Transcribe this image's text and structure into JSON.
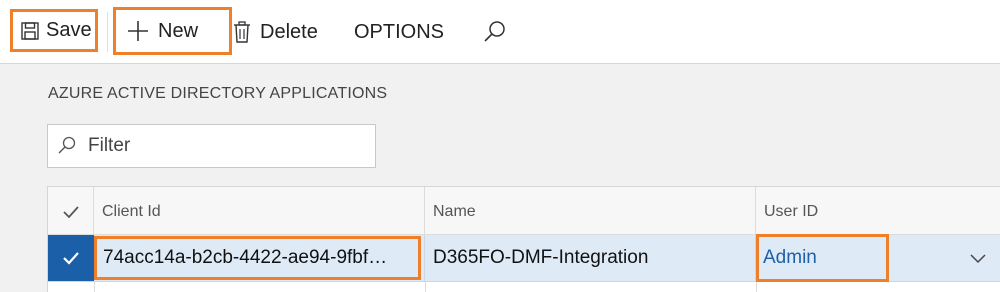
{
  "toolbar": {
    "save_label": "Save",
    "new_label": "New",
    "delete_label": "Delete",
    "options_label": "OPTIONS",
    "icons": {
      "save": "floppy-disk-icon",
      "new": "plus-icon",
      "delete": "trash-icon",
      "search": "search-icon"
    }
  },
  "section": {
    "title": "AZURE ACTIVE DIRECTORY APPLICATIONS"
  },
  "filter": {
    "placeholder": "Filter",
    "value": ""
  },
  "grid": {
    "columns": [
      "Client Id",
      "Name",
      "User ID"
    ],
    "rows": [
      {
        "selected": true,
        "client_id": "74acc14a-b2cb-4422-ae94-9fbf…",
        "name": "D365FO-DMF-Integration",
        "user_id": "Admin"
      }
    ]
  },
  "colors": {
    "highlight": "#f07f2a",
    "selected_row": "#deebf7",
    "check_cell": "#1a5fa8",
    "link": "#1f5fa8"
  }
}
